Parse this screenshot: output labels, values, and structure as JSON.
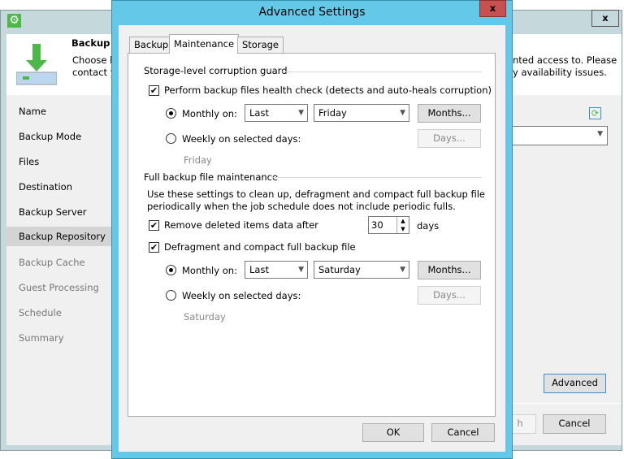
{
  "background_wizard": {
    "title": "Backup R",
    "description_line1": "Choose b",
    "description_line2": "contact y",
    "description_right1": "nted access to. Please",
    "description_right2": "y availability issues.",
    "close_label": "x",
    "nav": [
      {
        "label": "Name",
        "state": "done"
      },
      {
        "label": "Backup Mode",
        "state": "done"
      },
      {
        "label": "Files",
        "state": "done"
      },
      {
        "label": "Destination",
        "state": "done"
      },
      {
        "label": "Backup Server",
        "state": "done"
      },
      {
        "label": "Backup Repository",
        "state": "selected"
      },
      {
        "label": "Backup Cache",
        "state": "disabled"
      },
      {
        "label": "Guest Processing",
        "state": "disabled"
      },
      {
        "label": "Schedule",
        "state": "disabled"
      },
      {
        "label": "Summary",
        "state": "disabled"
      }
    ],
    "advanced_label": "Advanced",
    "finish_label": "h",
    "cancel_label": "Cancel"
  },
  "dialog": {
    "title": "Advanced Settings",
    "close_label": "x",
    "tabs": [
      {
        "label": "Backup"
      },
      {
        "label": "Maintenance",
        "active": true
      },
      {
        "label": "Storage"
      }
    ],
    "corruption_guard": {
      "heading": "Storage-level corruption guard",
      "health_check_label": "Perform backup files health check (detects and auto-heals corruption)",
      "health_check_checked": true,
      "monthly_label": "Monthly on:",
      "monthly_selected": true,
      "monthly_week": "Last",
      "monthly_day": "Friday",
      "months_button": "Months...",
      "weekly_label": "Weekly on selected days:",
      "days_button": "Days...",
      "weekly_summary": "Friday"
    },
    "full_maintenance": {
      "heading": "Full backup file maintenance",
      "description_line1": "Use these settings to clean up, defragment and compact full backup file",
      "description_line2": "periodically when the job schedule does not include periodic fulls.",
      "remove_deleted_label": "Remove deleted items data after",
      "remove_deleted_checked": true,
      "remove_days_value": "30",
      "days_unit": "days",
      "defrag_label": "Defragment and compact full backup file",
      "defrag_checked": true,
      "monthly_label": "Monthly on:",
      "monthly_selected": true,
      "monthly_week": "Last",
      "monthly_day": "Saturday",
      "months_button": "Months...",
      "weekly_label": "Weekly on selected days:",
      "days_button": "Days...",
      "weekly_summary": "Saturday"
    },
    "ok_label": "OK",
    "cancel_label": "Cancel"
  },
  "colors": {
    "dialog_frame": "#64c8e8",
    "close_button": "#c75050",
    "accent_green": "#4cb848"
  }
}
